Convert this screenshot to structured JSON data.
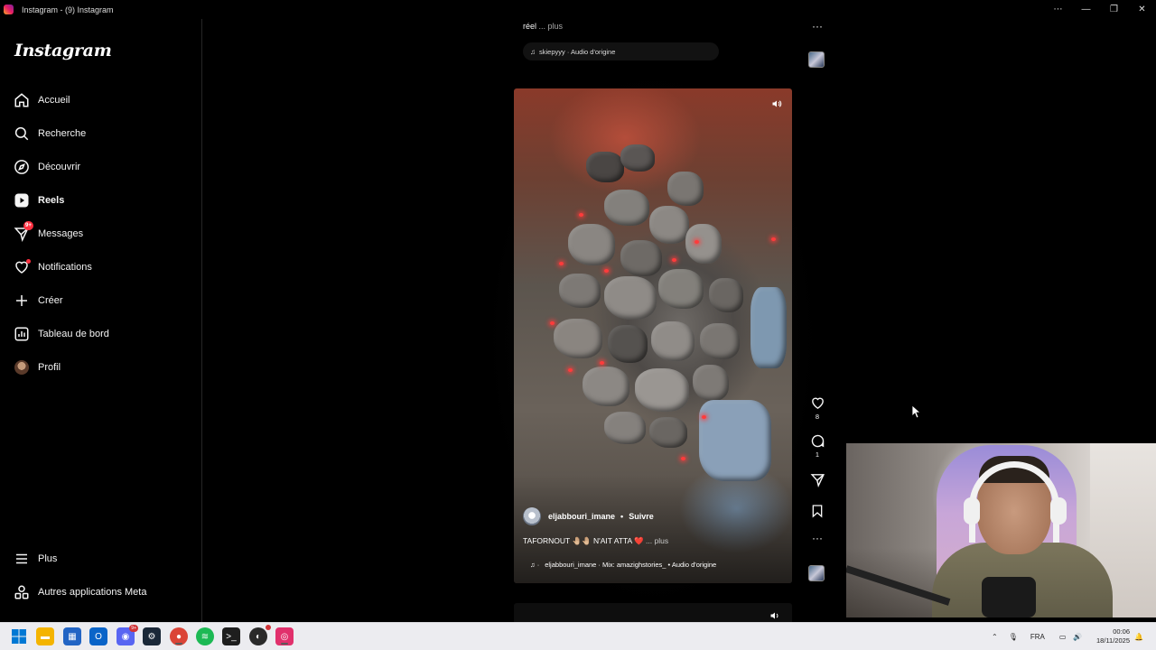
{
  "window": {
    "title": "Instagram - (9) Instagram",
    "controls": [
      "⋯",
      "—",
      "❐",
      "✕"
    ]
  },
  "sidebar": {
    "logo": "Instagram",
    "items": [
      {
        "label": "Accueil",
        "icon": "home-icon"
      },
      {
        "label": "Recherche",
        "icon": "search-icon"
      },
      {
        "label": "Découvrir",
        "icon": "compass-icon"
      },
      {
        "label": "Reels",
        "icon": "reels-icon",
        "active": true
      },
      {
        "label": "Messages",
        "icon": "messenger-icon",
        "badge": "9+"
      },
      {
        "label": "Notifications",
        "icon": "heart-icon",
        "dot": true
      },
      {
        "label": "Créer",
        "icon": "plus-icon"
      },
      {
        "label": "Tableau de bord",
        "icon": "dashboard-icon"
      },
      {
        "label": "Profil",
        "icon": "avatar-icon"
      }
    ],
    "bottom": [
      {
        "label": "Plus",
        "icon": "menu-icon"
      },
      {
        "label": "Autres applications Meta",
        "icon": "meta-apps-icon"
      }
    ]
  },
  "previous_post": {
    "caption": "réel",
    "more": "... plus",
    "audio": "skiepyyy · Audio d'origine"
  },
  "reel": {
    "username": "eljabbouri_imane",
    "separator": "•",
    "follow": "Suivre",
    "caption": "TAFORNOUT 🤚🏼🤚🏼 N'AIT ATTA ❤️",
    "more": "... plus",
    "audio": "eljabbouri_imane · Mix: amazighstories_ • Audio d'origine",
    "likes": "8",
    "comments": "1"
  },
  "taskbar": {
    "apps": [
      {
        "name": "windows-start-icon",
        "color": "#0078d4"
      },
      {
        "name": "file-explorer-icon",
        "color": "#f4b400"
      },
      {
        "name": "store-icon",
        "color": "#2264c4"
      },
      {
        "name": "outlook-icon",
        "color": "#0a64c8"
      },
      {
        "name": "discord-icon",
        "color": "#5865f2",
        "badge": "9+"
      },
      {
        "name": "steam-icon",
        "color": "#1b2838"
      },
      {
        "name": "chrome-icon",
        "color": "#db4437"
      },
      {
        "name": "spotify-icon",
        "color": "#1db954"
      },
      {
        "name": "terminal-icon",
        "color": "#1e1e1e"
      },
      {
        "name": "app-icon",
        "color": "#2a2a2a",
        "badge": ""
      },
      {
        "name": "instagram-icon",
        "color": "#e1306c",
        "active": true
      }
    ],
    "tray_language": "FRA",
    "time": "00:06",
    "date": "18/11/2025"
  }
}
